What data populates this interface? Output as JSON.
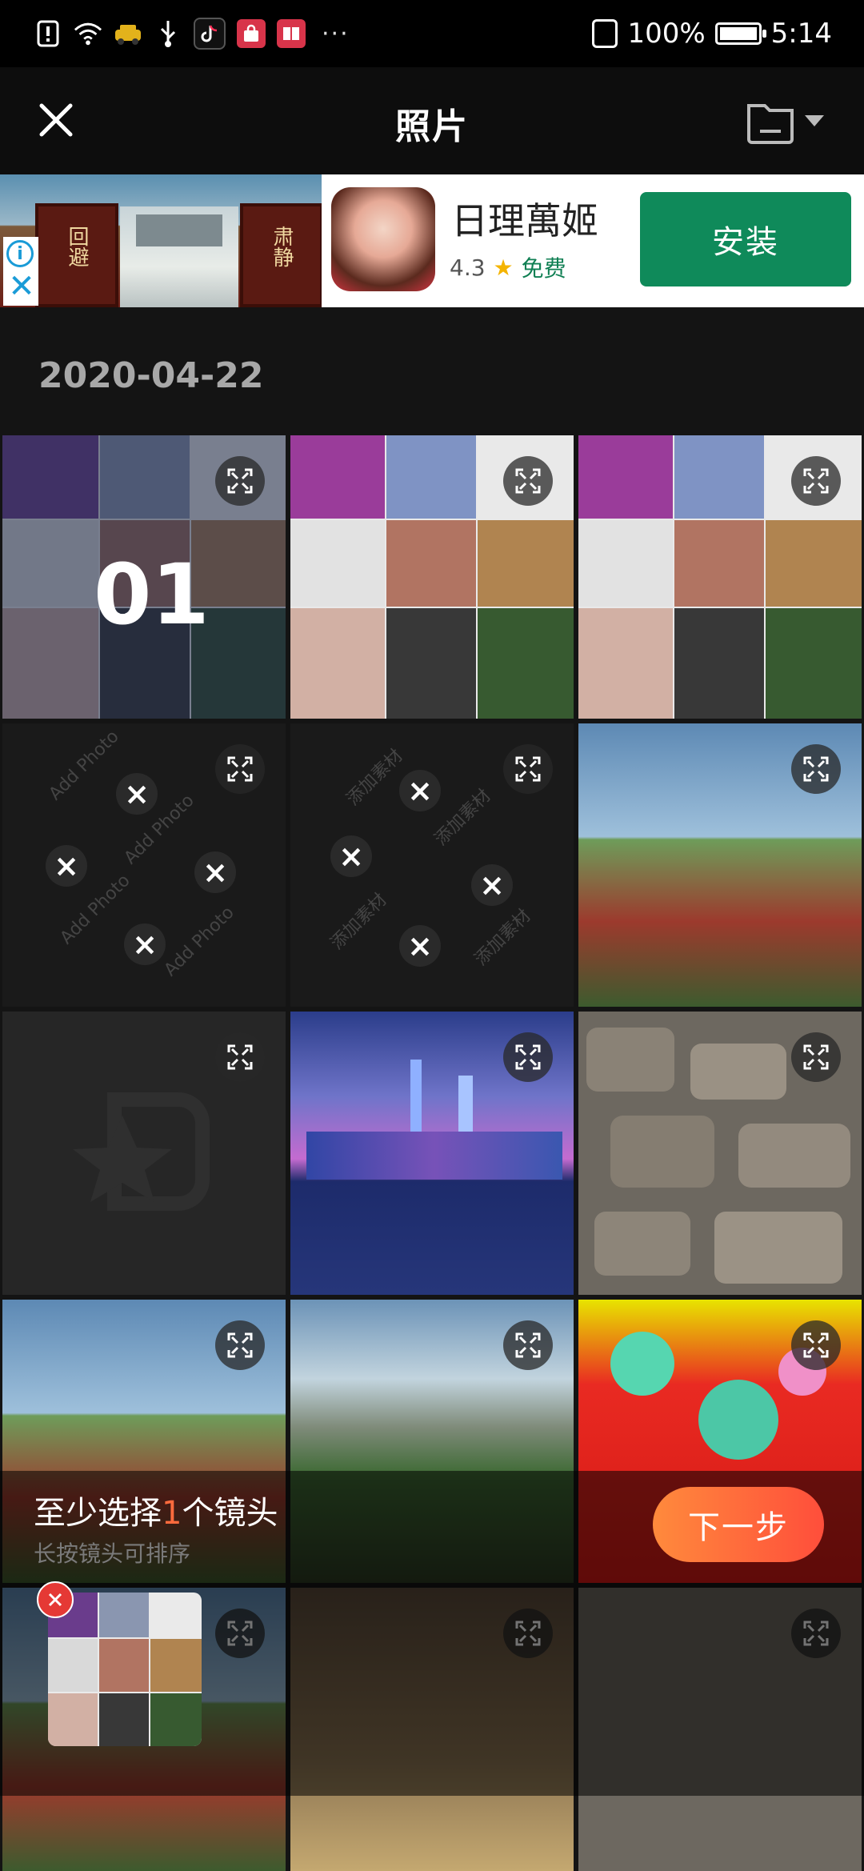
{
  "status_bar": {
    "battery": "100%",
    "time": "5:14",
    "more": "···"
  },
  "header": {
    "title": "照片",
    "close_icon": "close-icon",
    "folder_icon": "folder-icon"
  },
  "ad": {
    "banner_left_text": "回避",
    "banner_right_text": "肃静",
    "app_name": "日理萬姬",
    "rating": "4.3",
    "price": "免费",
    "install": "安装",
    "info_symbol": "i",
    "close_symbol": "✕"
  },
  "gallery": {
    "date": "2020-04-22",
    "first_selected_index": "01",
    "placeholder_en": "Add Photo",
    "placeholder_cn": "添加素材"
  },
  "bottom": {
    "hint_prefix": "至少选择",
    "hint_count": "1",
    "hint_suffix": "个镜头",
    "sub_hint": "长按镜头可排序",
    "next": "下一步"
  },
  "colors": {
    "accent": "#ff5a3c",
    "install_green": "#0f8a5a",
    "background": "#141414"
  }
}
